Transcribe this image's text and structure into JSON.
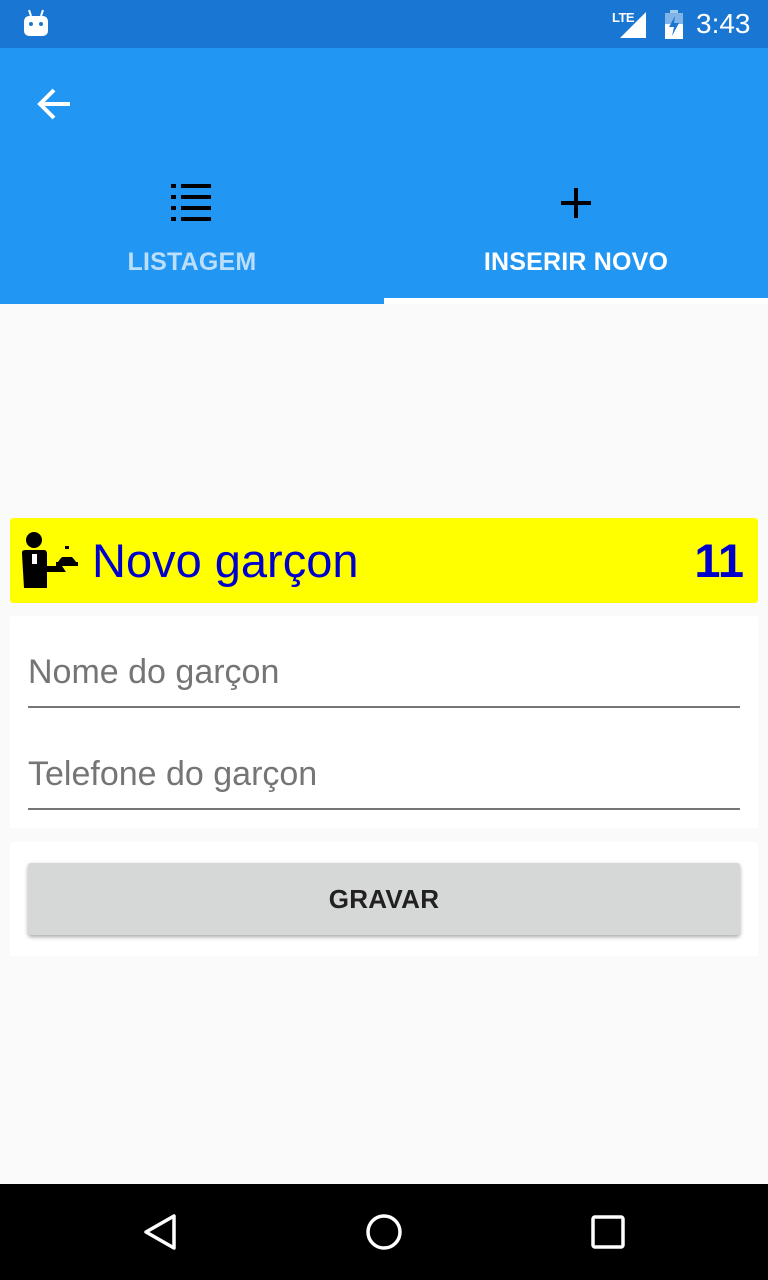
{
  "status_bar": {
    "network": "LTE",
    "time": "3:43",
    "icons": [
      "android-notification-icon",
      "signal-icon",
      "battery-icon"
    ]
  },
  "app_bar": {
    "back_icon": "arrow-back-icon",
    "tabs": [
      {
        "label": "LISTAGEM",
        "icon": "list-icon",
        "selected": false
      },
      {
        "label": "INSERIR NOVO",
        "icon": "plus-icon",
        "selected": true
      }
    ],
    "colors": {
      "status": "#1976d2",
      "primary": "#2196f3",
      "indicator": "#ffffff"
    }
  },
  "header": {
    "icon": "waiter-icon",
    "title": "Novo garçon",
    "count": "11",
    "background": "#ffff00",
    "text_color": "#0000cc"
  },
  "form": {
    "name_field": {
      "placeholder": "Nome do garçon",
      "value": ""
    },
    "phone_field": {
      "placeholder": "Telefone do garçon",
      "value": ""
    }
  },
  "actions": {
    "save_label": "GRAVAR"
  },
  "nav_bar": {
    "icons": [
      "nav-back-icon",
      "nav-home-icon",
      "nav-recents-icon"
    ]
  }
}
